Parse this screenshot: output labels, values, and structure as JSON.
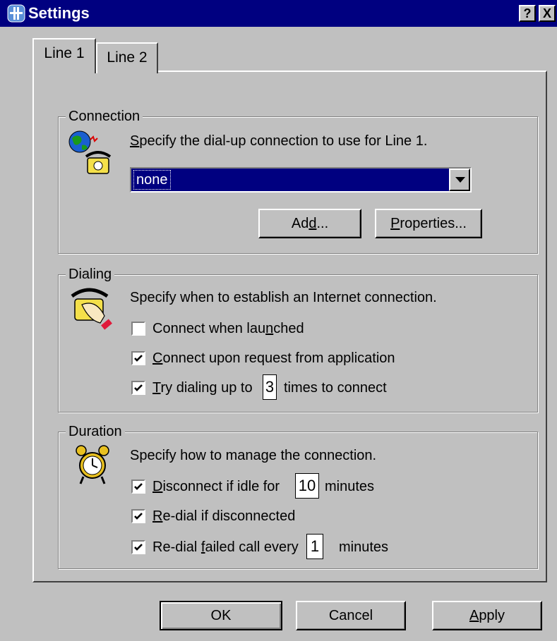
{
  "window": {
    "title": "Settings",
    "help_label": "?",
    "close_label": "X"
  },
  "tabs": [
    {
      "label": "Line 1",
      "active": true
    },
    {
      "label": "Line 2",
      "active": false
    }
  ],
  "connection": {
    "group_label": "Connection",
    "description_first": "S",
    "description_rest": "pecify the dial-up connection to use for Line 1.",
    "dropdown_value": "none",
    "add_button_pre": "Ad",
    "add_button_u": "d",
    "add_button_post": "...",
    "properties_button_u": "P",
    "properties_button_post": "roperties..."
  },
  "dialing": {
    "group_label": "Dialing",
    "description": "Specify when to establish an Internet connection.",
    "connect_when_launched": {
      "pre": "Connect when lau",
      "u": "n",
      "post": "ched",
      "checked": false
    },
    "connect_upon_request": {
      "u": "C",
      "post": "onnect upon request from application",
      "checked": true
    },
    "try_dialing": {
      "u": "T",
      "post": "ry dialing up to",
      "value": "3",
      "after": "times to connect",
      "checked": true
    }
  },
  "duration": {
    "group_label": "Duration",
    "description": "Specify how to manage the connection.",
    "disconnect_idle": {
      "u": "D",
      "post": "isconnect if idle for",
      "value": "10",
      "after": "minutes",
      "checked": true
    },
    "redial_disconnected": {
      "u": "R",
      "post": "e-dial if disconnected",
      "checked": true
    },
    "redial_failed": {
      "pre": "Re-dial ",
      "u": "f",
      "post": "ailed call every",
      "value": "1",
      "after": "minutes",
      "checked": true
    }
  },
  "footer": {
    "ok_label": "OK",
    "cancel_label": "Cancel",
    "apply_u": "A",
    "apply_post": "pply"
  },
  "colors": {
    "titlebar": "#000080",
    "face": "#c0c0c0",
    "highlight": "#000080"
  }
}
